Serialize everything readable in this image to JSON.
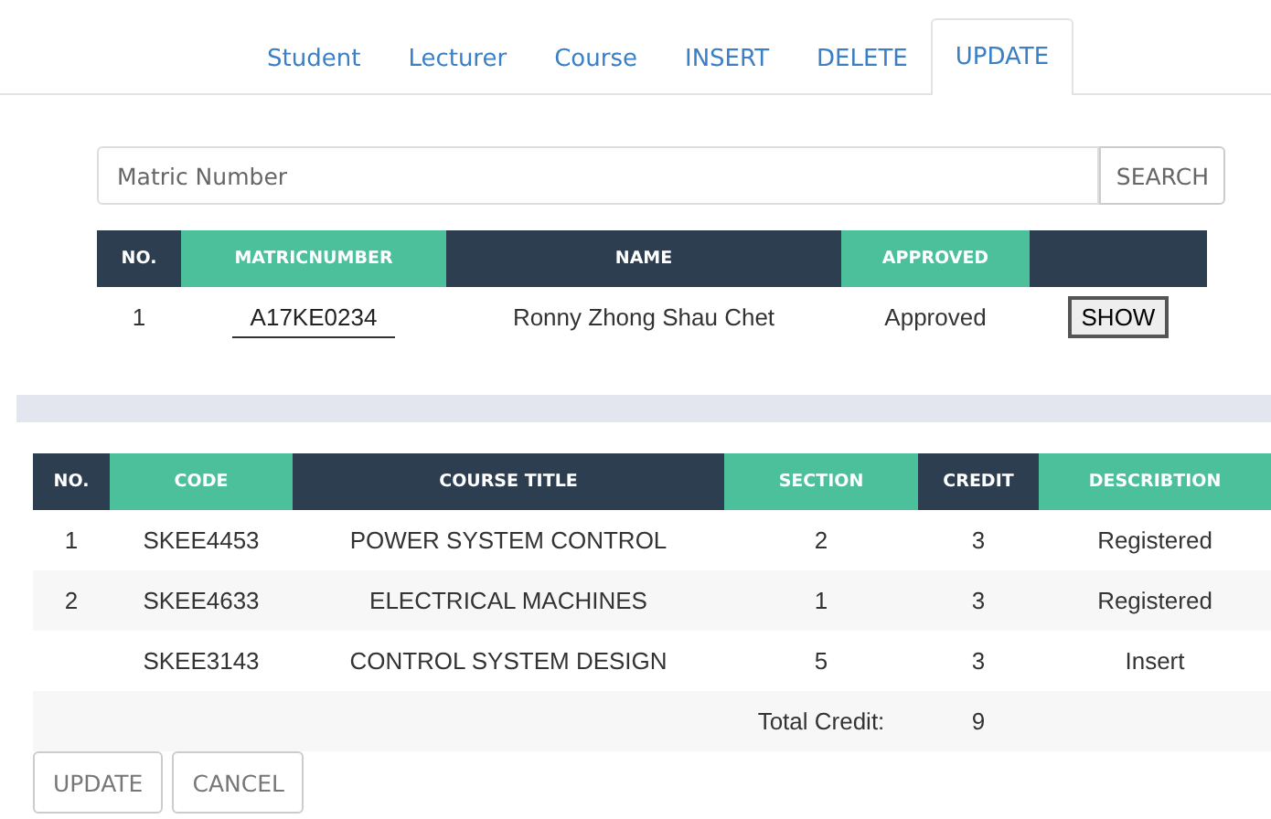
{
  "tabs": [
    {
      "label": "Student",
      "selected": false
    },
    {
      "label": "Lecturer",
      "selected": false
    },
    {
      "label": "Course",
      "selected": false
    },
    {
      "label": "INSERT",
      "selected": false
    },
    {
      "label": "DELETE",
      "selected": false
    },
    {
      "label": "UPDATE",
      "selected": true
    }
  ],
  "search": {
    "placeholder": "Matric Number",
    "button": "SEARCH"
  },
  "student_table": {
    "columns": [
      "NO.",
      "MATRICNUMBER",
      "NAME",
      "APPROVED"
    ],
    "rows": [
      {
        "no": "1",
        "matric": "A17KE0234",
        "name": "Ronny Zhong Shau Chet",
        "approved": "Approved",
        "action": "SHOW"
      }
    ]
  },
  "course_table": {
    "columns": [
      "NO.",
      "CODE",
      "COURSE TITLE",
      "SECTION",
      "CREDIT",
      "DESCRIBTION"
    ],
    "rows": [
      [
        "1",
        "SKEE4453",
        "POWER SYSTEM CONTROL",
        "2",
        "3",
        "Registered"
      ],
      [
        "2",
        "SKEE4633",
        "ELECTRICAL MACHINES",
        "1",
        "3",
        "Registered"
      ],
      [
        null,
        "SKEE3143",
        "CONTROL SYSTEM DESIGN",
        "5",
        "3",
        "Insert"
      ]
    ],
    "total": {
      "label": "Total Credit:",
      "value": "9"
    }
  },
  "buttons": [
    "UPDATE",
    "CANCEL"
  ]
}
